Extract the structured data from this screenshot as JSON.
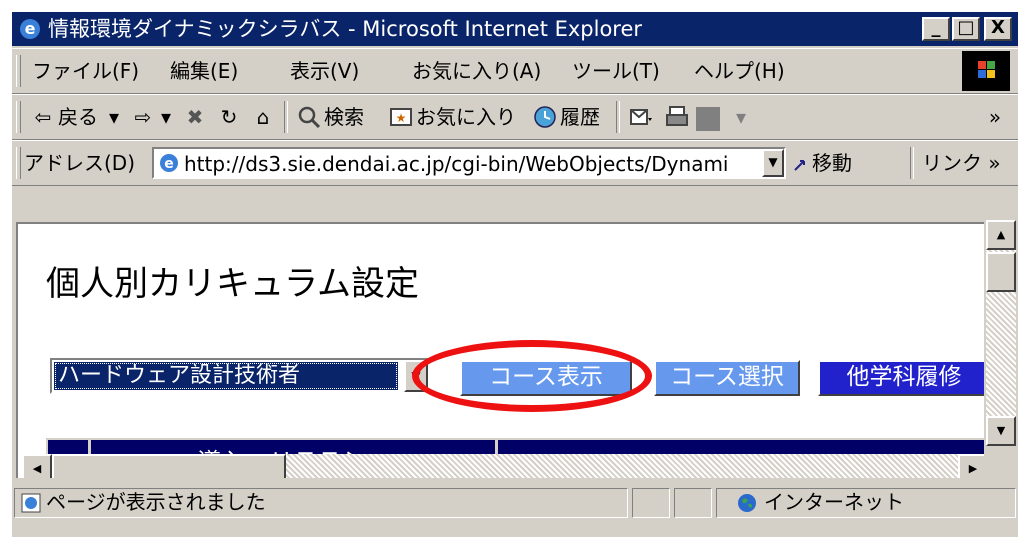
{
  "window": {
    "title": "情報環境ダイナミックシラバス - Microsoft Internet Explorer",
    "minimize": "_",
    "maximize": "□",
    "close": "X"
  },
  "menu": {
    "items": [
      "ファイル(F)",
      "編集(E)",
      "表示(V)",
      "お気に入り(A)",
      "ツール(T)",
      "ヘルプ(H)"
    ]
  },
  "toolbar": {
    "back_label": "戻る",
    "back_arrow": "⇦",
    "forward_arrow": "⇨",
    "dropdown": "▾",
    "stop": "✖",
    "refresh": "↻",
    "home": "⌂",
    "search_label": "検索",
    "favorites_label": "お気に入り",
    "history_label": "履歴",
    "more": "»"
  },
  "address_bar": {
    "label": "アドレス(D)",
    "url": "http://ds3.sie.dendai.ac.jp/cgi-bin/WebObjects/Dynami",
    "go_label": "移動",
    "links_label": "リンク »"
  },
  "page": {
    "title": "個人別カリキュラム設定",
    "course_select": {
      "selected": "ハードウェア設計技術者"
    },
    "buttons": {
      "show_course": "コース表示",
      "select_course": "コース選択",
      "other_dept": "他学科履修"
    },
    "table_header_partial": "導入・リテラシー"
  },
  "scroll": {
    "up": "▲",
    "down": "▼",
    "left": "◀",
    "right": "▶"
  },
  "status": {
    "message": "ページが表示されました",
    "zone": "インターネット"
  },
  "colors": {
    "titlebar": "#0a246a",
    "button_light": "#6699ee",
    "button_dark": "#2222cc",
    "table_header": "#000066",
    "highlight_ring": "#ee1111"
  },
  "icons": [
    "ie-logo-icon",
    "windows-logo-icon",
    "back-arrow-icon",
    "forward-arrow-icon",
    "stop-icon",
    "refresh-icon",
    "home-icon",
    "search-icon",
    "favorites-icon",
    "history-icon",
    "mail-icon",
    "print-icon",
    "go-icon",
    "globe-icon"
  ]
}
